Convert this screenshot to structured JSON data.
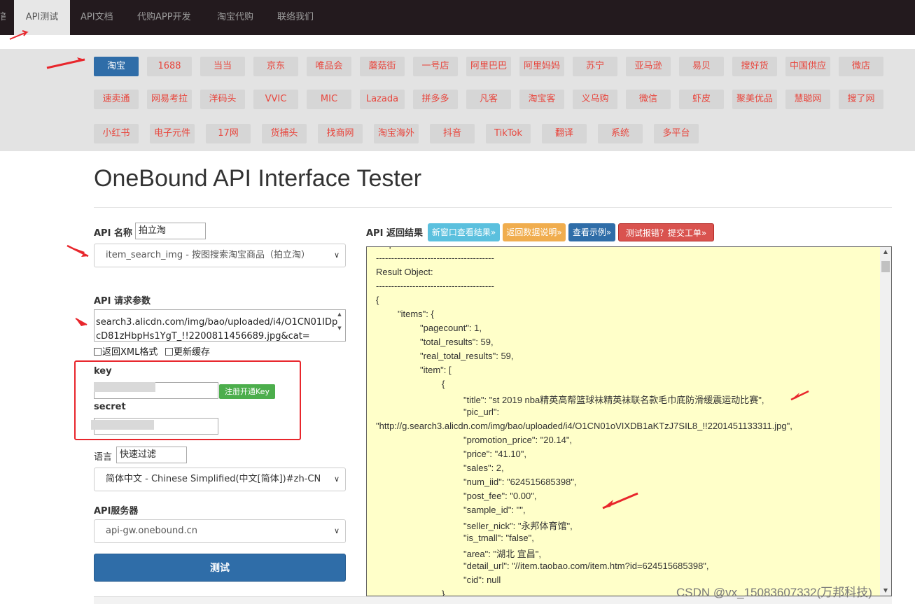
{
  "nav": {
    "items": [
      {
        "label": "首",
        "active": false
      },
      {
        "label": "API测试",
        "active": true
      },
      {
        "label": "API文档",
        "active": false
      },
      {
        "label": "代购APP开发",
        "active": false
      },
      {
        "label": "淘宝代购",
        "active": false
      },
      {
        "label": "联络我们",
        "active": false
      }
    ]
  },
  "platforms": [
    "淘宝",
    "1688",
    "当当",
    "京东",
    "唯品会",
    "蘑菇街",
    "一号店",
    "阿里巴巴",
    "阿里妈妈",
    "苏宁",
    "亚马逊",
    "易贝",
    "搜好货",
    "中国供应",
    "微店",
    "速卖通",
    "网易考拉",
    "洋码头",
    "VVIC",
    "MIC",
    "Lazada",
    "拼多多",
    "凡客",
    "淘宝客",
    "义乌购",
    "微信",
    "虾皮",
    "聚美优品",
    "慧聪网",
    "搜了网",
    "小红书",
    "电子元件",
    "17网",
    "货捕头",
    "找商网",
    "淘宝海外",
    "抖音",
    "TikTok",
    "翻译",
    "系统",
    "多平台"
  ],
  "active_platform": "淘宝",
  "page_title": "OneBound API Interface Tester",
  "form": {
    "api_name_label": "API 名称",
    "api_name_value": "拍立淘",
    "api_select": "item_search_img - 按图搜索淘宝商品（拍立淘）",
    "params_label": "API 请求参数",
    "params_lines": [
      "search3.alicdn.com/img/bao/uploaded/i4/O1CN01IDp",
      "cD81zHbpHs1YgT_!!2200811456689.jpg&cat="
    ],
    "chk_xml": "返回XML格式",
    "chk_cache": "更新缓存",
    "key_label": "key",
    "secret_label": "secret",
    "register_btn": "注册开通Key",
    "lang_label": "语言",
    "lang_filter": "快速过滤",
    "lang_select": "简体中文 - Chinese Simplified(中文[简体])#zh-CN",
    "server_label": "API服务器",
    "server_select": "api-gw.onebound.cn",
    "test_btn": "测试"
  },
  "result": {
    "label": "API 返回结果",
    "buttons": [
      {
        "label": "新窗口查看结果»",
        "color": "#5bc0de"
      },
      {
        "label": "返回数据说明»",
        "color": "#f0ad4e"
      },
      {
        "label": "查看示例»",
        "color": "#2f6da8"
      },
      {
        "label": "测试报错？提交工单»",
        "color": "#d9534f"
      }
    ],
    "lines": [
      "---------------------------------------",
      "Result Object:",
      "---------------------------------------",
      "{",
      "\"items\": {",
      "\"pagecount\": 1,",
      "\"total_results\": 59,",
      "\"real_total_results\": 59,",
      "\"item\": [",
      "{",
      "\"title\": \"st 2019 nba精英高帮篮球袜精英袜联名款毛巾底防滑缓震运动比赛\",",
      "\"pic_url\":",
      "\"http://g.search3.alicdn.com/img/bao/uploaded/i4/O1CN01oVIXDB1aKTzJ7SIL8_!!2201451133311.jpg\",",
      "\"promotion_price\": \"20.14\",",
      "\"price\": \"41.10\",",
      "\"sales\": 2,",
      "\"num_iid\": \"624515685398\",",
      "\"post_fee\": \"0.00\",",
      "\"sample_id\": \"\",",
      "\"seller_nick\": \"永邦体育馆\",",
      "\"is_tmall\": \"false\",",
      "\"area\": \"湖北 宜昌\",",
      "\"detail_url\": \"//item.taobao.com/item.htm?id=624515685398\",",
      "\"cid\": null",
      "}"
    ]
  },
  "watermark": "CSDN @vx_15083607332(万邦科技)",
  "colors": {
    "nav_bg": "#231a1e",
    "platform_text": "#e8453c",
    "active_blue": "#2f6da8",
    "result_bg": "#ffffc9",
    "annotation_red": "#e8262c"
  }
}
